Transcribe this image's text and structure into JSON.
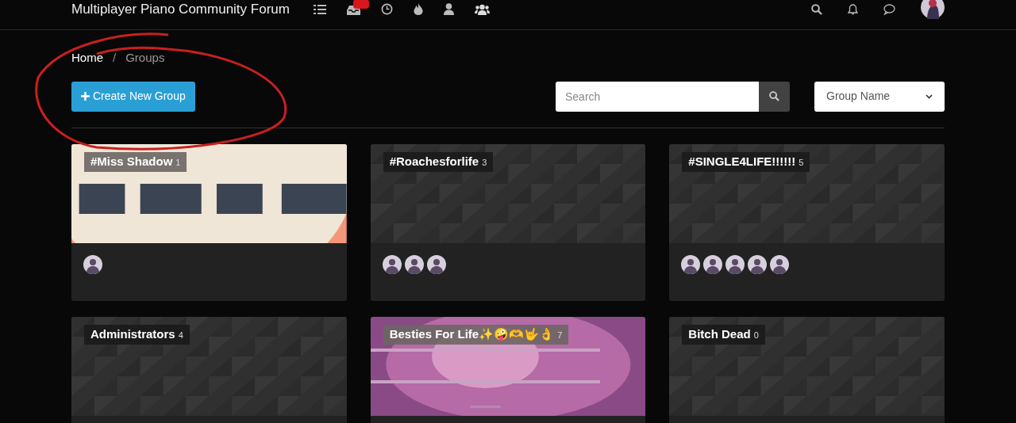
{
  "navbar": {
    "title": "Multiplayer Piano Community Forum",
    "unread_badge": true
  },
  "breadcrumb_separator": "/",
  "breadcrumb": [
    {
      "label": "Home",
      "selected": false
    },
    {
      "label": "Groups",
      "selected": true
    }
  ],
  "create_button": "Create New Group",
  "search": {
    "placeholder": "Search"
  },
  "sort_select": {
    "value": "Group Name"
  },
  "groups": [
    {
      "name": "#Miss Shadow",
      "count": "1",
      "kind": "picture",
      "members": [
        {
          "kind": "avatar"
        }
      ]
    },
    {
      "name": "#Roachesforlife",
      "count": "3",
      "kind": "pattern",
      "members": [
        {
          "kind": "avatar"
        },
        {
          "kind": "avatar"
        },
        {
          "kind": "avatar"
        }
      ]
    },
    {
      "name": "#SINGLE4LIFE!!!!!!",
      "count": "5",
      "kind": "pattern",
      "members": [
        {
          "kind": "avatar"
        },
        {
          "kind": "avatar"
        },
        {
          "kind": "avatar"
        },
        {
          "kind": "avatar"
        },
        {
          "kind": "avatar"
        }
      ]
    },
    {
      "name": "Administrators",
      "count": "4",
      "kind": "pattern"
    },
    {
      "name": "Besties For Life✨🤪🫶🤟👌",
      "count": "7",
      "kind": "picture"
    },
    {
      "name": "Bitch Dead",
      "count": "0",
      "kind": "pattern"
    }
  ]
}
